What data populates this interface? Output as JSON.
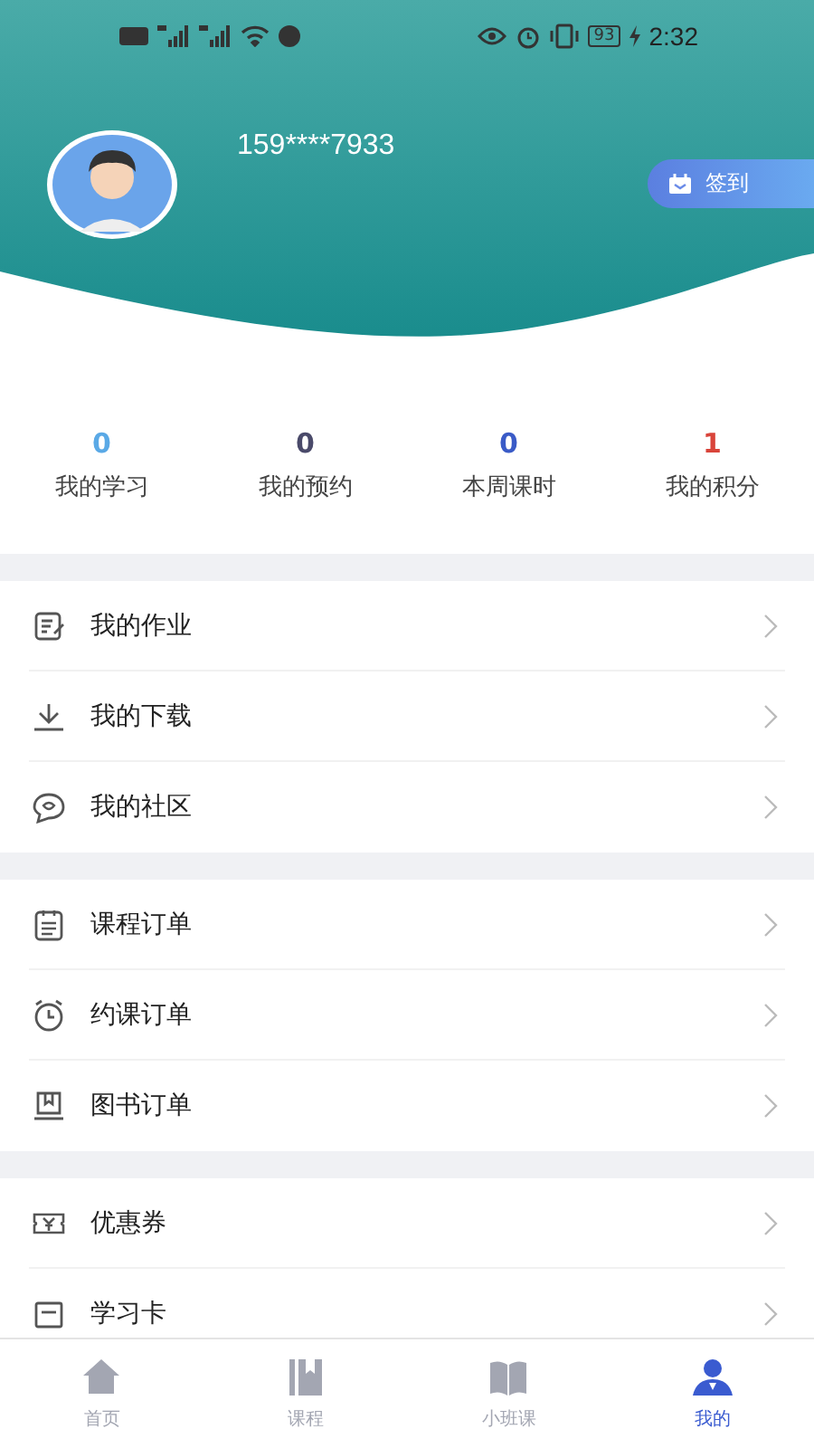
{
  "status_bar": {
    "time": "2:32",
    "battery": "93"
  },
  "profile": {
    "phone": "159****7933",
    "checkin_button": "签到"
  },
  "stats": [
    {
      "value": "0",
      "label": "我的学习",
      "color": "#5aa9e6"
    },
    {
      "value": "0",
      "label": "我的预约",
      "color": "#4a4a6a"
    },
    {
      "value": "0",
      "label": "本周课时",
      "color": "#3a5bc7"
    },
    {
      "value": "1",
      "label": "我的积分",
      "color": "#d9443a"
    }
  ],
  "menu_groups": [
    [
      {
        "kind": "homework",
        "label": "我的作业"
      },
      {
        "kind": "download",
        "label": "我的下载"
      },
      {
        "kind": "chat",
        "label": "我的社区"
      }
    ],
    [
      {
        "kind": "list",
        "label": "课程订单"
      },
      {
        "kind": "clock",
        "label": "约课订单"
      },
      {
        "kind": "book",
        "label": "图书订单"
      }
    ],
    [
      {
        "kind": "coupon",
        "label": "优惠券"
      },
      {
        "kind": "card",
        "label": "学习卡"
      }
    ]
  ],
  "tab_bar": [
    {
      "kind": "home",
      "label": "首页",
      "selected": false
    },
    {
      "kind": "course",
      "label": "课程",
      "selected": false
    },
    {
      "kind": "openbook",
      "label": "小班课",
      "selected": false
    },
    {
      "kind": "person",
      "label": "我的",
      "selected": true
    }
  ]
}
